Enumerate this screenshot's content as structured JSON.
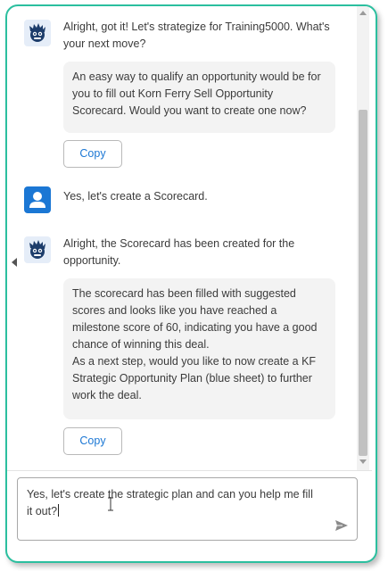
{
  "colors": {
    "frame_border": "#2bbf9f",
    "bubble_bg": "#f3f3f3",
    "button_text": "#1b77d4",
    "user_avatar": "#1b77d4",
    "bot_avatar_bg": "#e5edf8"
  },
  "messages": [
    {
      "sender": "bot",
      "avatar_icon": "bot-mascot-icon",
      "text": "Alright, got it! Let's strategize for Training5000. What's your next move?",
      "bubble": "An easy way to qualify an opportunity would be for you to fill out Korn Ferry Sell Opportunity Scorecard. Would you want to create one now?",
      "copy_label": "Copy"
    },
    {
      "sender": "user",
      "avatar_icon": "user-icon",
      "text": "Yes, let's create a Scorecard."
    },
    {
      "sender": "bot",
      "avatar_icon": "bot-mascot-icon",
      "text": "Alright, the Scorecard has been created for the opportunity.",
      "bubble_lines": [
        "The scorecard has been filled with suggested scores and looks like you have reached a milestone score of 60, indicating you have a good chance of winning this deal.",
        "As a next step, would you like to now create a KF Strategic Opportunity Plan (blue sheet) to further work the deal."
      ],
      "copy_label": "Copy"
    }
  ],
  "composer": {
    "value": "Yes, let's create the strategic plan and can you help me fill it out?",
    "send_icon": "send-icon"
  }
}
